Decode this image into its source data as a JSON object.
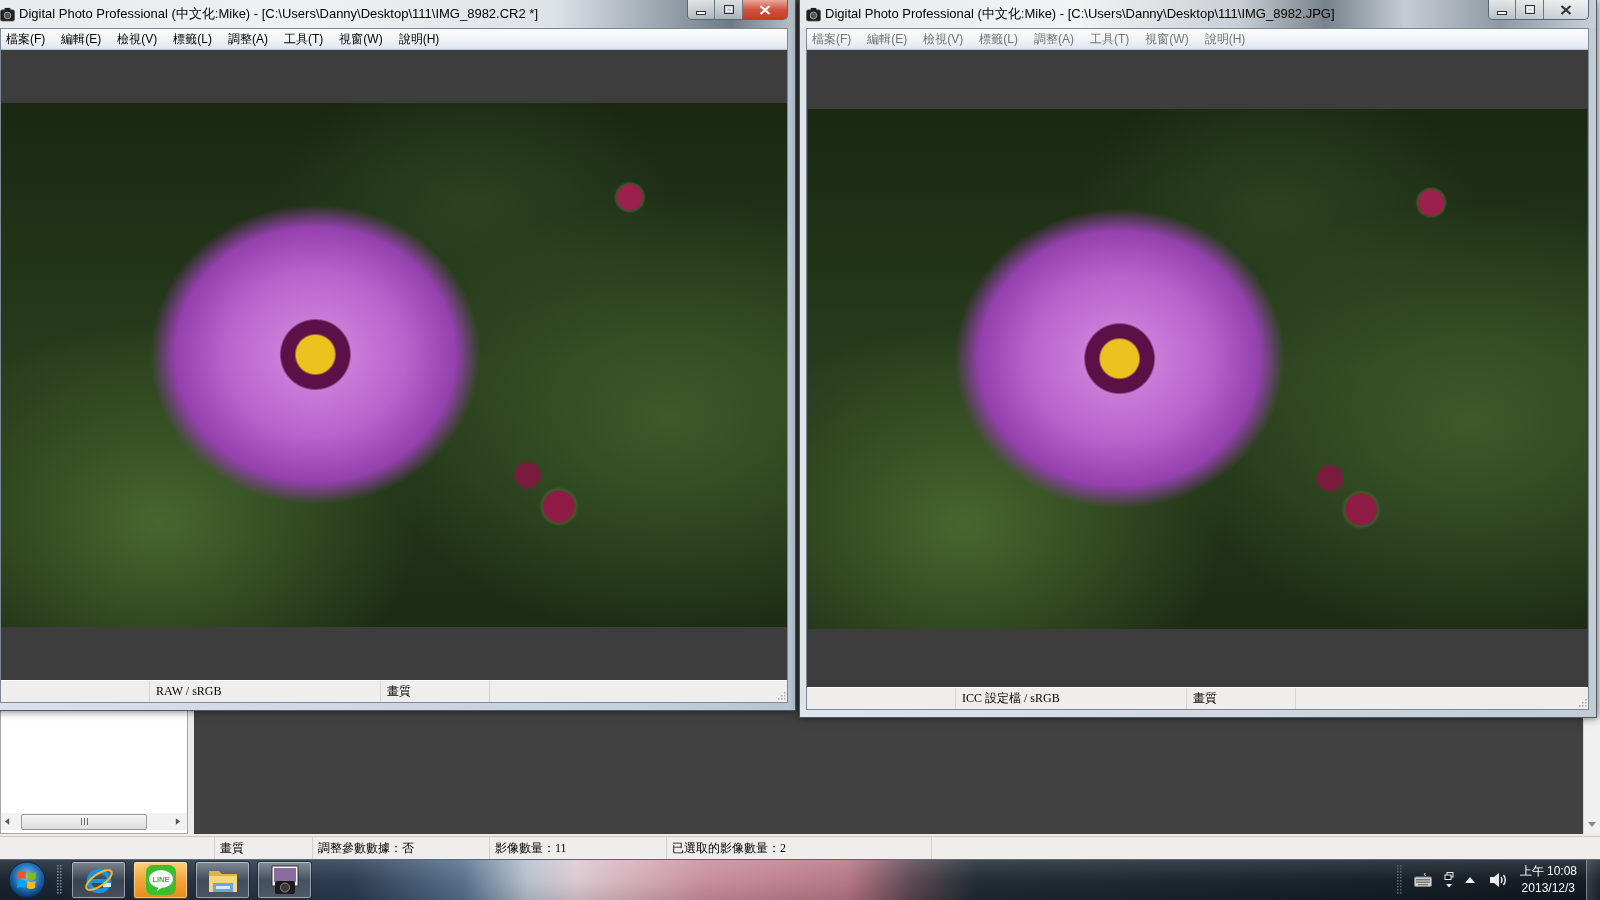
{
  "windows": [
    {
      "title": "Digital Photo Professional (中文化:Mike) - [C:\\Users\\Danny\\Desktop\\111\\IMG_8982.CR2 *]",
      "active": true,
      "menu": [
        "檔案(F)",
        "編輯(E)",
        "檢視(V)",
        "標籤(L)",
        "調整(A)",
        "工具(T)",
        "視窗(W)",
        "說明(H)"
      ],
      "status_bar": [
        "RAW / sRGB",
        "畫質"
      ]
    },
    {
      "title": "Digital Photo Professional (中文化:Mike) - [C:\\Users\\Danny\\Desktop\\111\\IMG_8982.JPG]",
      "active": false,
      "menu": [
        "檔案(F)",
        "編輯(E)",
        "檢視(V)",
        "標籤(L)",
        "調整(A)",
        "工具(T)",
        "視窗(W)",
        "說明(H)"
      ],
      "status_bar": [
        "ICC 設定檔 / sRGB",
        "畫質"
      ]
    }
  ],
  "main_status_bar": [
    "畫質",
    "調整參數數據：否",
    "影像數量：11",
    "已選取的影像數量：2"
  ],
  "taskbar": {
    "apps": [
      {
        "kind": "browser",
        "attention": false
      },
      {
        "kind": "chat",
        "attention": true,
        "logo_text": "LINE"
      },
      {
        "kind": "folder",
        "attention": false
      },
      {
        "kind": "photo_app",
        "attention": false
      }
    ],
    "clock": {
      "time": "上午 10:08",
      "date": "2013/12/3"
    }
  }
}
